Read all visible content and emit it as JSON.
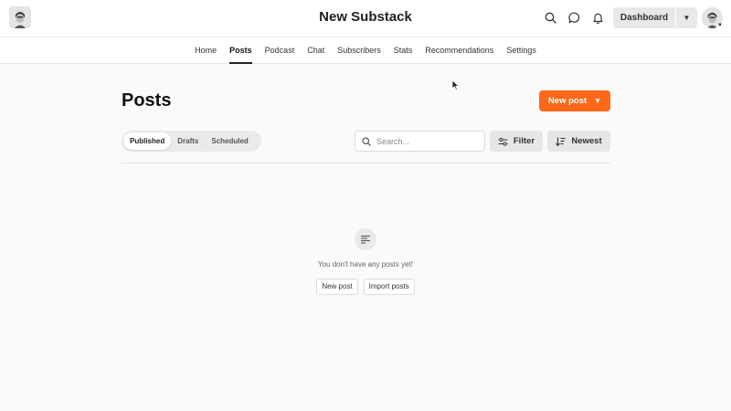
{
  "app": {
    "title": "New Substack"
  },
  "topbar": {
    "dashboard_label": "Dashboard"
  },
  "subnav": {
    "items": [
      {
        "label": "Home"
      },
      {
        "label": "Posts"
      },
      {
        "label": "Podcast"
      },
      {
        "label": "Chat"
      },
      {
        "label": "Subscribers"
      },
      {
        "label": "Stats"
      },
      {
        "label": "Recommendations"
      },
      {
        "label": "Settings"
      }
    ],
    "active": "Posts"
  },
  "main": {
    "title": "Posts",
    "new_post_label": "New post",
    "tabs": [
      {
        "label": "Published"
      },
      {
        "label": "Drafts"
      },
      {
        "label": "Scheduled"
      }
    ],
    "search": {
      "placeholder": "Search...",
      "value": ""
    },
    "filter_label": "Filter",
    "sort_label": "Newest",
    "empty": {
      "message": "You don't have any posts yet!",
      "new_post_label": "New post",
      "import_label": "Import posts"
    }
  },
  "colors": {
    "accent": "#ff6719"
  }
}
